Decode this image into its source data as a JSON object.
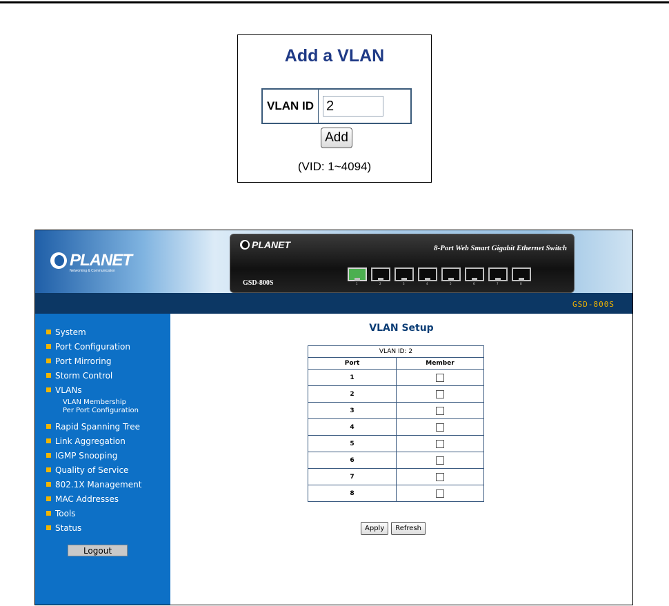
{
  "add_vlan": {
    "title": "Add a VLAN",
    "label": "VLAN ID",
    "value": "2",
    "button": "Add",
    "range_note": "(VID: 1~4094)"
  },
  "banner": {
    "logo": "PLANET",
    "logo_sub": "Networking & Communication",
    "device_logo": "PLANET",
    "device_title": "8-Port Web Smart Gigabit Ethernet Switch",
    "device_model": "GSD-800S",
    "ports": [
      {
        "label": "1",
        "active": true
      },
      {
        "label": "2",
        "active": false
      },
      {
        "label": "3",
        "active": false
      },
      {
        "label": "4",
        "active": false
      },
      {
        "label": "5",
        "active": false
      },
      {
        "label": "6",
        "active": false
      },
      {
        "label": "7",
        "active": false
      },
      {
        "label": "8",
        "active": false
      }
    ],
    "model_label": "GSD-800S"
  },
  "sidebar": {
    "items": [
      "System",
      "Port Configuration",
      "Port Mirroring",
      "Storm Control",
      "VLANs",
      "Rapid Spanning Tree",
      "Link Aggregation",
      "IGMP Snooping",
      "Quality of Service",
      "802.1X Management",
      "MAC Addresses",
      "Tools",
      "Status"
    ],
    "vlan_sub": [
      "VLAN Membership",
      "Per Port Configuration"
    ],
    "logout": "Logout"
  },
  "vlan_setup": {
    "title": "VLAN Setup",
    "caption": "VLAN ID: 2",
    "col_port": "Port",
    "col_member": "Member",
    "rows": [
      {
        "port": "1",
        "member": false
      },
      {
        "port": "2",
        "member": false
      },
      {
        "port": "3",
        "member": false
      },
      {
        "port": "4",
        "member": false
      },
      {
        "port": "5",
        "member": false
      },
      {
        "port": "6",
        "member": false
      },
      {
        "port": "7",
        "member": false
      },
      {
        "port": "8",
        "member": false
      }
    ],
    "apply": "Apply",
    "refresh": "Refresh"
  },
  "colors": {
    "nav_bg": "#0d70c6",
    "model_bar": "#0c3764",
    "accent": "#f0b400",
    "title_blue": "#1f3a86"
  }
}
